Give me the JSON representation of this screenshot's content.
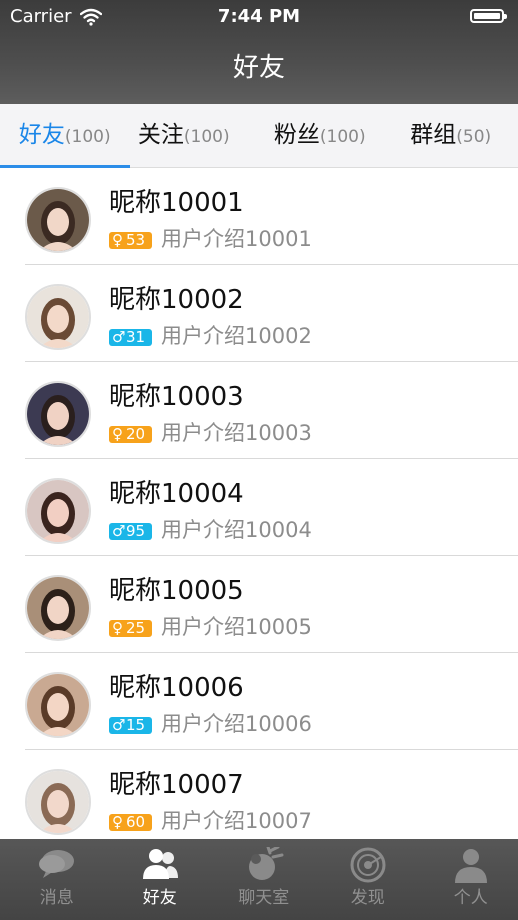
{
  "status_bar": {
    "carrier": "Carrier",
    "time": "7:44 PM"
  },
  "nav": {
    "title": "好友"
  },
  "tabs": [
    {
      "label": "好友",
      "count": "(100)",
      "active": true
    },
    {
      "label": "关注",
      "count": "(100)",
      "active": false
    },
    {
      "label": "粉丝",
      "count": "(100)",
      "active": false
    },
    {
      "label": "群组",
      "count": "(50)",
      "active": false
    }
  ],
  "friends": [
    {
      "nickname": "昵称10001",
      "gender": "female",
      "gender_icon": "female-icon",
      "age": "53",
      "intro": "用户介绍10001",
      "avatar_colors": [
        "#6b5a4a",
        "#f1d7c8",
        "#3b2a22"
      ]
    },
    {
      "nickname": "昵称10002",
      "gender": "male",
      "gender_icon": "male-icon",
      "age": "31",
      "intro": "用户介绍10002",
      "avatar_colors": [
        "#e9e3dc",
        "#f3d9c9",
        "#6a4a35"
      ]
    },
    {
      "nickname": "昵称10003",
      "gender": "female",
      "gender_icon": "female-icon",
      "age": "20",
      "intro": "用户介绍10003",
      "avatar_colors": [
        "#3c3a52",
        "#f0d2c4",
        "#2a1f1d"
      ]
    },
    {
      "nickname": "昵称10004",
      "gender": "male",
      "gender_icon": "male-icon",
      "age": "95",
      "intro": "用户介绍10004",
      "avatar_colors": [
        "#d8c6c2",
        "#f2cfc3",
        "#3a241e"
      ]
    },
    {
      "nickname": "昵称10005",
      "gender": "female",
      "gender_icon": "female-icon",
      "age": "25",
      "intro": "用户介绍10005",
      "avatar_colors": [
        "#a98f78",
        "#f1d5c6",
        "#2c2019"
      ]
    },
    {
      "nickname": "昵称10006",
      "gender": "male",
      "gender_icon": "male-icon",
      "age": "15",
      "intro": "用户介绍10006",
      "avatar_colors": [
        "#c9a992",
        "#f3d6c5",
        "#5a3b28"
      ]
    },
    {
      "nickname": "昵称10007",
      "gender": "female",
      "gender_icon": "female-icon",
      "age": "60",
      "intro": "用户介绍10007",
      "avatar_colors": [
        "#e6e2de",
        "#f2d8cb",
        "#8a6a55"
      ]
    }
  ],
  "tabbar": [
    {
      "label": "消息",
      "icon": "message-bubble-icon",
      "active": false
    },
    {
      "label": "好友",
      "icon": "friends-icon",
      "active": true
    },
    {
      "label": "聊天室",
      "icon": "chatroom-icon",
      "active": false
    },
    {
      "label": "发现",
      "icon": "radar-icon",
      "active": false
    },
    {
      "label": "个人",
      "icon": "person-icon",
      "active": false
    }
  ],
  "colors": {
    "accent": "#1a86e8",
    "female_badge": "#f7a21b",
    "male_badge": "#1ab6e8",
    "nav_bar": "#4a4a4a"
  }
}
